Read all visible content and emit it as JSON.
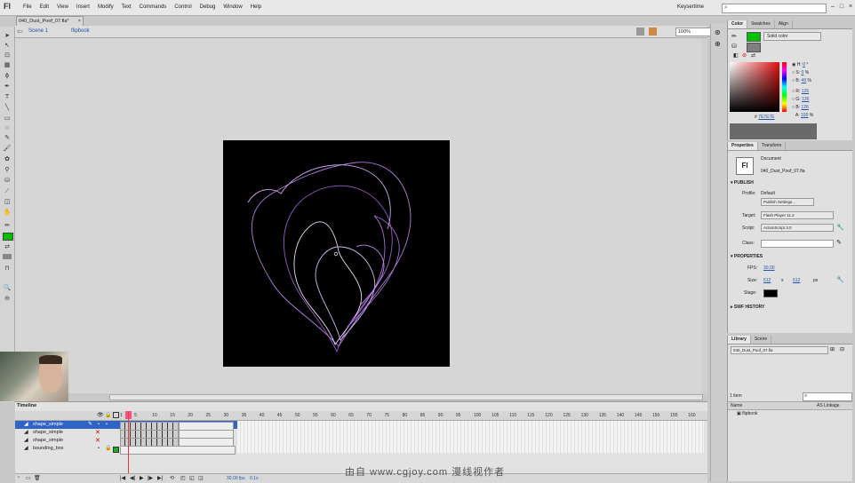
{
  "app": {
    "logo": "Fl",
    "workspace": "Keysertime"
  },
  "menu": [
    "File",
    "Edit",
    "View",
    "Insert",
    "Modify",
    "Text",
    "Commands",
    "Control",
    "Debug",
    "Window",
    "Help"
  ],
  "document": {
    "tab_title": "040_Dust_Poof_07.fla*",
    "close": "×"
  },
  "editbar": {
    "scene": "Scene 1",
    "symbol": "flipbook",
    "zoom": "100%"
  },
  "timeline": {
    "tab": "Timeline",
    "frame_numbers": [
      "1",
      "5",
      "10",
      "15",
      "20",
      "25",
      "30",
      "35",
      "40",
      "45",
      "50",
      "55",
      "60",
      "65",
      "70",
      "75",
      "80",
      "85",
      "90",
      "95",
      "100",
      "105",
      "110",
      "115",
      "120",
      "125",
      "130",
      "135",
      "140",
      "145",
      "150",
      "155",
      "160"
    ],
    "layers": [
      {
        "name": "shape_simple",
        "selected": true
      },
      {
        "name": "shape_simple",
        "selected": false
      },
      {
        "name": "shape_simple",
        "selected": false
      },
      {
        "name": "bounding_box",
        "selected": false
      }
    ],
    "footer": {
      "fps": "30.00 fps",
      "time": "0.1s"
    }
  },
  "color_panel": {
    "tabs": [
      "Color",
      "Swatches",
      "Align"
    ],
    "fill_type": "Solid color",
    "fill_color": "#00c000",
    "hsb": [
      {
        "label": "H:",
        "value": "0",
        "unit": "°"
      },
      {
        "label": "S:",
        "value": "0",
        "unit": "%"
      },
      {
        "label": "B:",
        "value": "49",
        "unit": "%"
      }
    ],
    "rgb": [
      {
        "label": "R:",
        "value": "126"
      },
      {
        "label": "G:",
        "value": "126"
      },
      {
        "label": "B:",
        "value": "126"
      },
      {
        "label": "A:",
        "value": "100",
        "unit": "%"
      }
    ],
    "hex": "7E7E7E"
  },
  "properties": {
    "tabs": [
      "Properties",
      "Transform"
    ],
    "doc_icon": "Fl",
    "doc_type": "Document",
    "doc_name": "040_Dust_Poof_07.fla",
    "publish_header": "PUBLISH",
    "profile_label": "Profile:",
    "profile_value": "Default",
    "publish_settings": "Publish Settings...",
    "target_label": "Target:",
    "target_value": "Flash Player 11.2",
    "script_label": "Script:",
    "script_value": "ActionScript 3.0",
    "class_label": "Class:",
    "props_header": "PROPERTIES",
    "fps_label": "FPS:",
    "fps_value": "30.00",
    "size_label": "Size:",
    "width": "512",
    "x_sep": "x",
    "height": "512",
    "unit": "px",
    "stage_label": "Stage:",
    "stage_color": "#000000",
    "swf_header": "SWF HISTORY"
  },
  "library": {
    "tabs": [
      "Library",
      "Scene"
    ],
    "file": "040_Dust_Poof_07.fla",
    "count": "1 item",
    "col_name": "Name",
    "col_linkage": "AS Linkage",
    "items": [
      "flipbook"
    ]
  },
  "watermark": "由自 www.cgjoy.com 漫线视作者"
}
